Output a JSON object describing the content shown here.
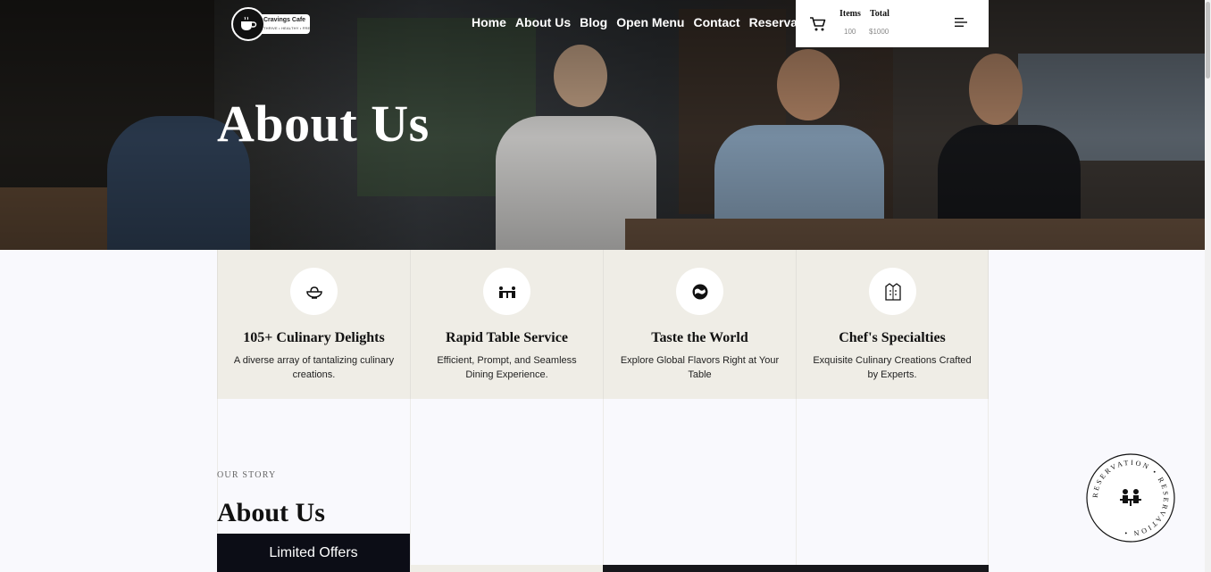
{
  "hero": {
    "title": "About Us"
  },
  "brand": {
    "name": "Cravings Cafe",
    "tagline": "THRIVE • HEALTHY • FRE"
  },
  "nav": {
    "items": [
      "Home",
      "About Us",
      "Blog",
      "Open Menu",
      "Contact",
      "Reservation"
    ]
  },
  "cart": {
    "items_label": "Items",
    "items_value": "100",
    "total_label": "Total",
    "total_value": "$1000",
    "icon": "cart-icon",
    "menu_icon": "hamburger-icon"
  },
  "features": [
    {
      "icon": "bowl-icon",
      "title": "105+ Culinary Delights",
      "desc": "A diverse array of tantalizing culinary creations."
    },
    {
      "icon": "dining-table-icon",
      "title": "Rapid Table Service",
      "desc": "Efficient, Prompt, and Seamless Dining Experience."
    },
    {
      "icon": "globe-icon",
      "title": "Taste the World",
      "desc": "Explore Global Flavors Right at Your Table"
    },
    {
      "icon": "chef-jacket-icon",
      "title": "Chef's Specialties",
      "desc": "Exquisite Culinary Creations Crafted by Experts."
    }
  ],
  "story": {
    "eyebrow": "OUR STORY",
    "title": "About Us",
    "offers_label": "Limited Offers"
  },
  "reservation_badge": {
    "text": "RESERVATION • RESERVATION •",
    "icon": "table-people-icon"
  },
  "colors": {
    "feature_bg": "#efede6",
    "offers_bg": "#0c0d16",
    "page_bg": "#f9f9fd"
  }
}
